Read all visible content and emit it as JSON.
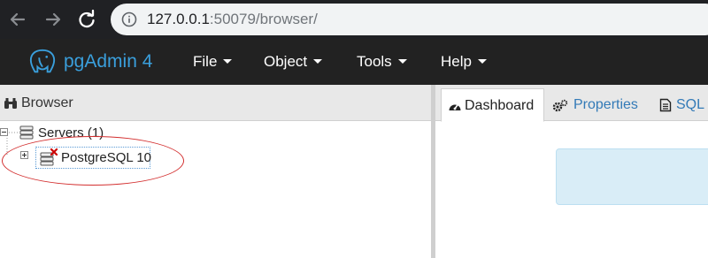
{
  "browser": {
    "url_host": "127.0.0.1",
    "url_rest": ":50079/browser/"
  },
  "app": {
    "brand": "pgAdmin 4",
    "menus": [
      "File",
      "Object",
      "Tools",
      "Help"
    ]
  },
  "browser_panel": {
    "title": "Browser",
    "tree": {
      "servers_label": "Servers (1)",
      "server_label": "PostgreSQL 10"
    }
  },
  "right_panel": {
    "tabs": [
      "Dashboard",
      "Properties",
      "SQL"
    ]
  },
  "colors": {
    "accent": "#3a9fdc",
    "navbar": "#222222",
    "annotation": "#d32f2f"
  }
}
